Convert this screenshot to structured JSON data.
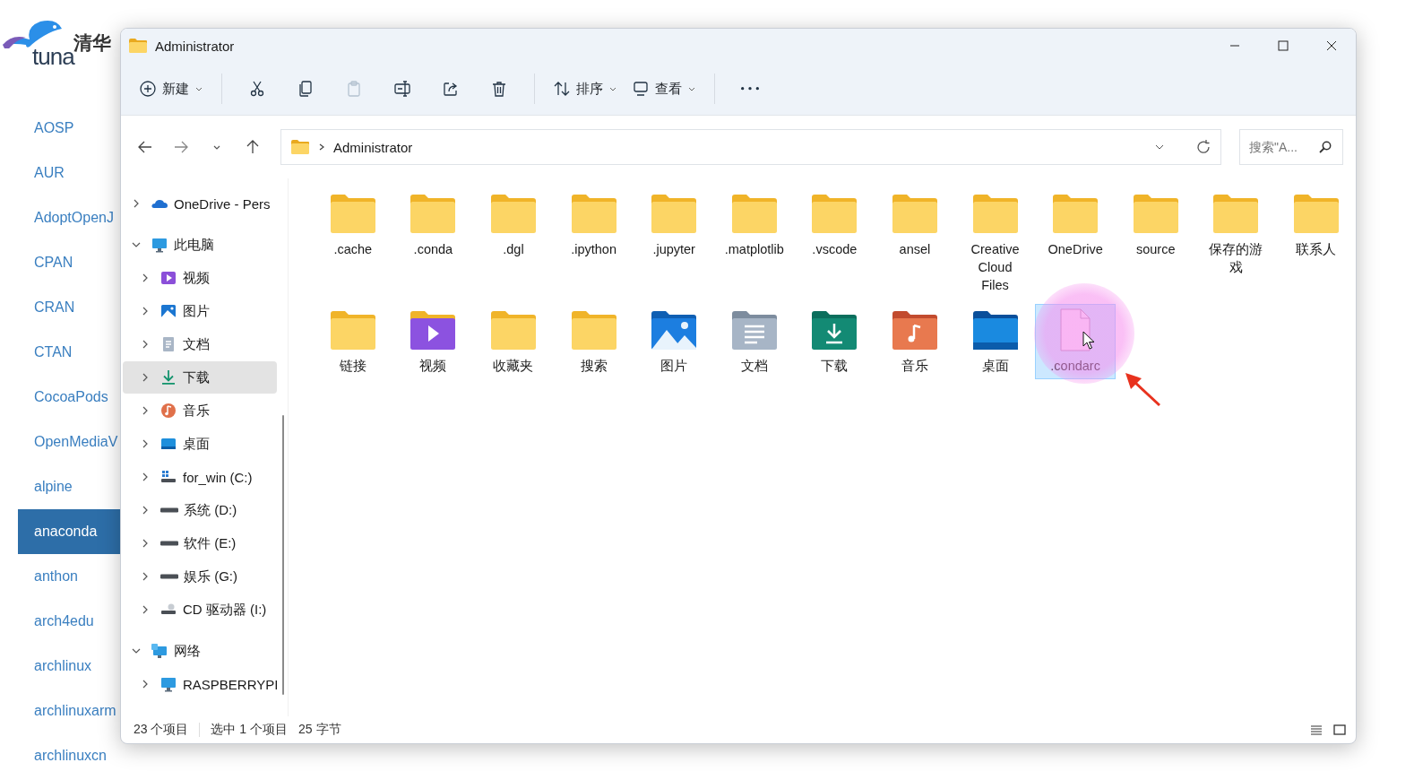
{
  "site": {
    "logo_word": "tuna",
    "logo_text": "清华",
    "links": [
      {
        "label": "AOSP",
        "selected": false
      },
      {
        "label": "AUR",
        "selected": false
      },
      {
        "label": "AdoptOpenJ",
        "selected": false
      },
      {
        "label": "CPAN",
        "selected": false
      },
      {
        "label": "CRAN",
        "selected": false
      },
      {
        "label": "CTAN",
        "selected": false
      },
      {
        "label": "CocoaPods",
        "selected": false
      },
      {
        "label": "OpenMediaV",
        "selected": false
      },
      {
        "label": "alpine",
        "selected": false
      },
      {
        "label": "anaconda",
        "selected": true
      },
      {
        "label": "anthon",
        "selected": false
      },
      {
        "label": "arch4edu",
        "selected": false
      },
      {
        "label": "archlinux",
        "selected": false
      },
      {
        "label": "archlinuxarm",
        "selected": false
      },
      {
        "label": "archlinuxcn",
        "selected": false
      }
    ]
  },
  "window": {
    "title": "Administrator",
    "toolbar": [
      {
        "kind": "new",
        "label": "新建",
        "disabled": false
      },
      {
        "kind": "cut",
        "disabled": false
      },
      {
        "kind": "copy",
        "disabled": false
      },
      {
        "kind": "paste",
        "disabled": true
      },
      {
        "kind": "rename",
        "disabled": false
      },
      {
        "kind": "share",
        "disabled": false
      },
      {
        "kind": "delete",
        "disabled": false
      },
      {
        "kind": "sort",
        "label": "排序",
        "disabled": false
      },
      {
        "kind": "view",
        "label": "查看",
        "disabled": false
      },
      {
        "kind": "more",
        "disabled": false
      }
    ],
    "address": {
      "path": "Administrator"
    },
    "search": {
      "placeholder": "搜索\"A..."
    },
    "nav": [
      {
        "label": "OneDrive - Pers",
        "kind": "cloud",
        "expanded": false,
        "selected": false
      },
      {
        "label": "此电脑",
        "kind": "pc",
        "expanded": true,
        "selected": false,
        "children": [
          {
            "label": "视频",
            "kind": "video",
            "expanded": false,
            "selected": false
          },
          {
            "label": "图片",
            "kind": "pictures",
            "expanded": false,
            "selected": false
          },
          {
            "label": "文档",
            "kind": "documents",
            "expanded": false,
            "selected": false
          },
          {
            "label": "下载",
            "kind": "downloads",
            "expanded": false,
            "selected": true
          },
          {
            "label": "音乐",
            "kind": "music",
            "expanded": false,
            "selected": false
          },
          {
            "label": "桌面",
            "kind": "desktop",
            "expanded": false,
            "selected": false
          },
          {
            "label": "for_win (C:)",
            "kind": "windrive",
            "expanded": false,
            "selected": false
          },
          {
            "label": "系统 (D:)",
            "kind": "drive",
            "expanded": false,
            "selected": false
          },
          {
            "label": "软件 (E:)",
            "kind": "drive",
            "expanded": false,
            "selected": false
          },
          {
            "label": "娱乐 (G:)",
            "kind": "drive",
            "expanded": false,
            "selected": false
          },
          {
            "label": "CD 驱动器 (I:)",
            "kind": "cd",
            "expanded": false,
            "selected": false
          }
        ]
      },
      {
        "label": "网络",
        "kind": "network",
        "expanded": true,
        "selected": false,
        "children": [
          {
            "label": "RASPBERRYPI",
            "kind": "pc",
            "expanded": false,
            "selected": false
          }
        ]
      }
    ],
    "files": [
      {
        "name": ".cache",
        "kind": "folder",
        "selected": false
      },
      {
        "name": ".conda",
        "kind": "folder",
        "selected": false
      },
      {
        "name": ".dgl",
        "kind": "folder",
        "selected": false
      },
      {
        "name": ".ipython",
        "kind": "folder",
        "selected": false
      },
      {
        "name": ".jupyter",
        "kind": "folder",
        "selected": false
      },
      {
        "name": ".matplotlib",
        "kind": "folder",
        "selected": false
      },
      {
        "name": ".vscode",
        "kind": "folder",
        "selected": false
      },
      {
        "name": "ansel",
        "kind": "folder",
        "selected": false
      },
      {
        "name": "Creative Cloud Files",
        "kind": "folder",
        "selected": false
      },
      {
        "name": "OneDrive",
        "kind": "folder",
        "selected": false
      },
      {
        "name": "source",
        "kind": "folder",
        "selected": false
      },
      {
        "name": "保存的游戏",
        "kind": "folder",
        "selected": false
      },
      {
        "name": "联系人",
        "kind": "folder",
        "selected": false
      },
      {
        "name": "链接",
        "kind": "folder",
        "selected": false
      },
      {
        "name": "视频",
        "kind": "video",
        "selected": false
      },
      {
        "name": "收藏夹",
        "kind": "folder",
        "selected": false
      },
      {
        "name": "搜索",
        "kind": "folder",
        "selected": false
      },
      {
        "name": "图片",
        "kind": "pictures",
        "selected": false
      },
      {
        "name": "文档",
        "kind": "documents",
        "selected": false
      },
      {
        "name": "下载",
        "kind": "downloads",
        "selected": false
      },
      {
        "name": "音乐",
        "kind": "music",
        "selected": false
      },
      {
        "name": "桌面",
        "kind": "desktop",
        "selected": false
      },
      {
        "name": ".condarc",
        "kind": "file",
        "selected": true
      }
    ],
    "status": {
      "count": "23 个项目",
      "selection": "选中 1 个项目",
      "size": "25 字节"
    }
  }
}
